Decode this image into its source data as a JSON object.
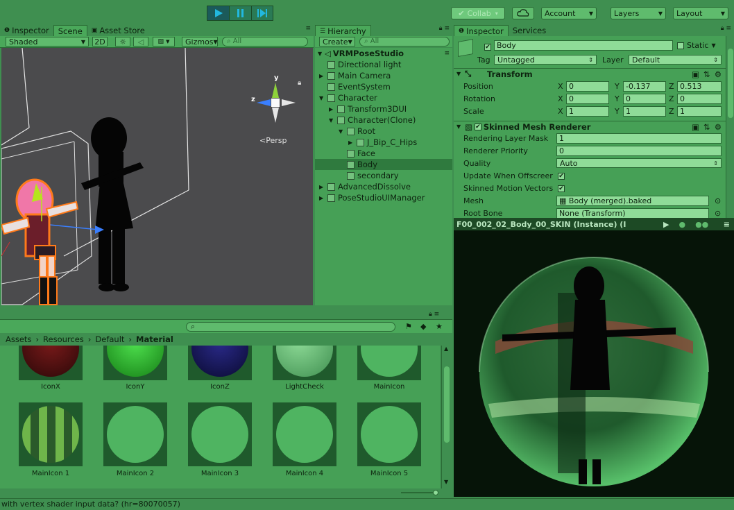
{
  "toolbar": {
    "play_icon": "play-icon",
    "pause_icon": "pause-icon",
    "step_icon": "step-icon",
    "collab_label": "Collab",
    "cloud_icon": "cloud-icon",
    "account_label": "Account",
    "layers_label": "Layers",
    "layout_label": "Layout"
  },
  "scene_panel": {
    "tabs": [
      {
        "label": "Inspector",
        "icon": "info-icon"
      },
      {
        "label": "Scene"
      },
      {
        "label": "Asset Store",
        "icon": "store-icon"
      }
    ],
    "shading_mode": "Shaded",
    "mode_2d_label": "2D",
    "gizmos_label": "Gizmos",
    "search_placeholder": "All",
    "persp_label": "Persp",
    "axis_y": "y",
    "axis_z": "z"
  },
  "hierarchy": {
    "tab_label": "Hierarchy",
    "create_label": "Create",
    "search_placeholder": "All",
    "scene_name": "VRMPoseStudio",
    "items": [
      {
        "label": "Directional light",
        "depth": 1,
        "arrow": ""
      },
      {
        "label": "Main Camera",
        "depth": 1,
        "arrow": "▶"
      },
      {
        "label": "EventSystem",
        "depth": 1,
        "arrow": ""
      },
      {
        "label": "Character",
        "depth": 1,
        "arrow": "▼"
      },
      {
        "label": "Transform3DUI",
        "depth": 2,
        "arrow": "▶"
      },
      {
        "label": "Character(Clone)",
        "depth": 2,
        "arrow": "▼"
      },
      {
        "label": "Root",
        "depth": 3,
        "arrow": "▼"
      },
      {
        "label": "J_Bip_C_Hips",
        "depth": 4,
        "arrow": "▶"
      },
      {
        "label": "Face",
        "depth": 3,
        "arrow": ""
      },
      {
        "label": "Body",
        "depth": 3,
        "arrow": "",
        "selected": true
      },
      {
        "label": "secondary",
        "depth": 3,
        "arrow": ""
      },
      {
        "label": "AdvancedDissolve",
        "depth": 1,
        "arrow": "▶"
      },
      {
        "label": "PoseStudioUIManager",
        "depth": 1,
        "arrow": "▶"
      }
    ]
  },
  "inspector": {
    "tabs": [
      {
        "label": "Inspector",
        "icon": "info-icon"
      },
      {
        "label": "Services"
      }
    ],
    "object_name": "Body",
    "static_label": "Static",
    "tag_label": "Tag",
    "tag_value": "Untagged",
    "layer_label": "Layer",
    "layer_value": "Default",
    "transform": {
      "title": "Transform",
      "position_label": "Position",
      "rotation_label": "Rotation",
      "scale_label": "Scale",
      "position": {
        "x": "0",
        "y": "-0.137",
        "z": "0.513"
      },
      "rotation": {
        "x": "0",
        "y": "0",
        "z": "0"
      },
      "scale": {
        "x": "1",
        "y": "1",
        "z": "1"
      },
      "axis_x": "X",
      "axis_y": "Y",
      "axis_z": "Z"
    },
    "smr": {
      "title": "Skinned Mesh Renderer",
      "rendering_layer_mask_label": "Rendering Layer Mask",
      "rendering_layer_mask_value": "1",
      "renderer_priority_label": "Renderer Priority",
      "renderer_priority_value": "0",
      "quality_label": "Quality",
      "quality_value": "Auto",
      "update_offscreen_label": "Update When Offscreer",
      "skinned_motion_label": "Skinned Motion Vectors",
      "mesh_label": "Mesh",
      "mesh_value": "Body (merged).baked",
      "root_bone_label": "Root Bone",
      "root_bone_value": "None (Transform)"
    }
  },
  "preview": {
    "title": "F00_002_02_Body_00_SKIN (Instance) (I"
  },
  "project": {
    "breadcrumb": [
      {
        "label": "Assets"
      },
      {
        "label": "Resources"
      },
      {
        "label": "Default"
      },
      {
        "label": "Material"
      }
    ],
    "assets_row1": [
      "IconX",
      "IconY",
      "IconZ",
      "LightCheck",
      "MainIcon"
    ],
    "assets_row2": [
      "MainIcon 1",
      "MainIcon 2",
      "MainIcon 3",
      "MainIcon 4",
      "MainIcon 5"
    ]
  },
  "status_bar": {
    "message": "with vertex shader input data? (hr=80070057)"
  },
  "colors": {
    "bg": "#3f8f50",
    "panel": "#46a056",
    "field": "#8fdc98",
    "selected": "#2f7a3e"
  }
}
